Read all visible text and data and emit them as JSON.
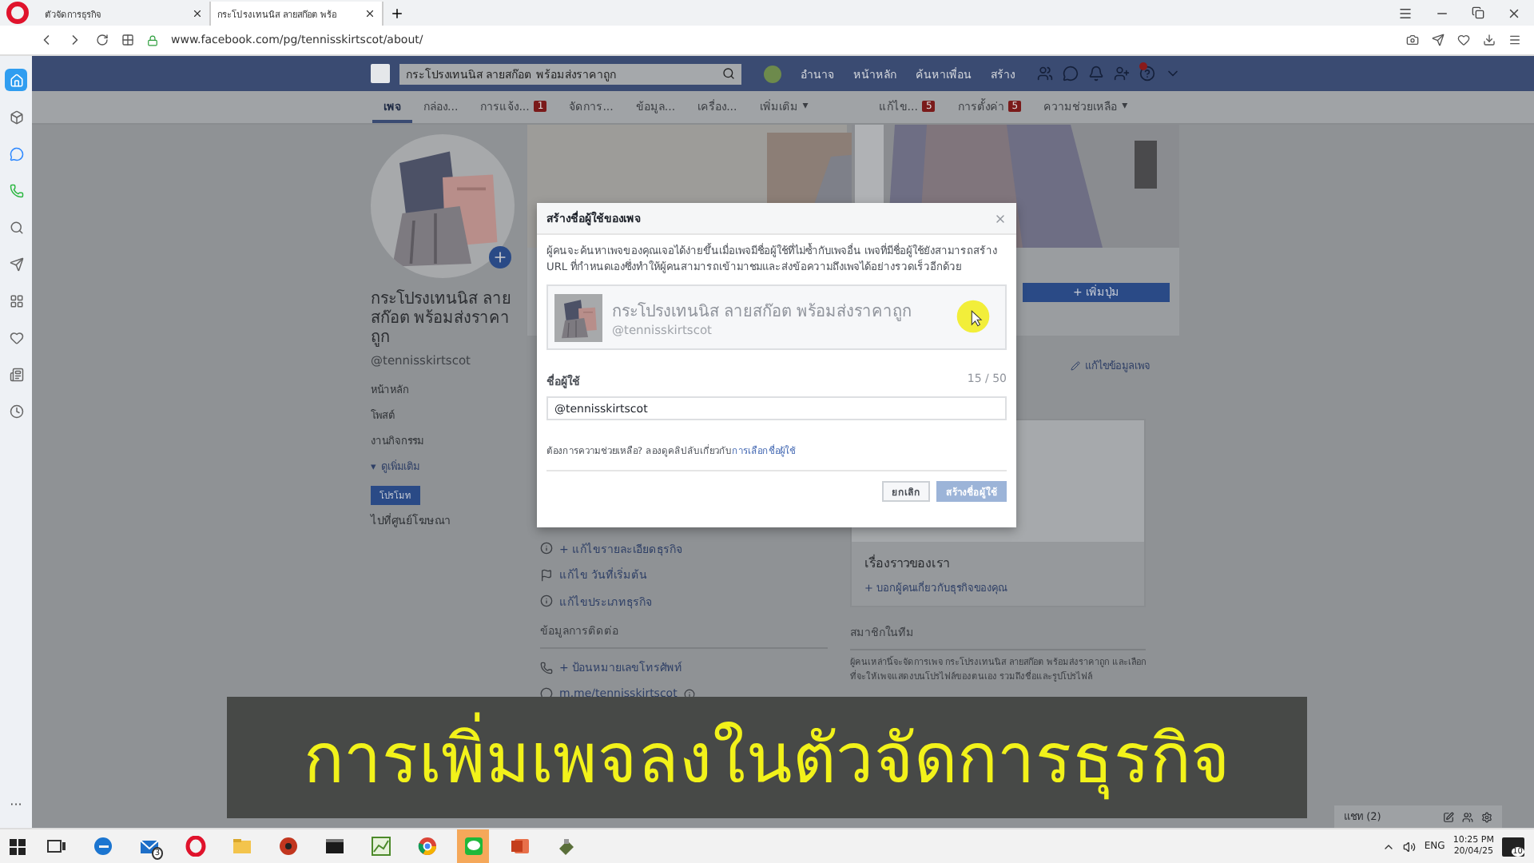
{
  "browser": {
    "tabs": [
      {
        "title": "ตัวจัดการธุรกิจ",
        "selected": false
      },
      {
        "title": "กระโปรงเทนนิส ลายสก๊อต พร้อ",
        "selected": true
      }
    ],
    "address": "www.facebook.com/pg/tennisskirtscot/about/"
  },
  "opera_sidebar": {
    "items": [
      {
        "kind": "home",
        "selected": true
      },
      {
        "kind": "box",
        "selected": false
      },
      {
        "kind": "messenger",
        "selected": false
      },
      {
        "kind": "whatsapp",
        "selected": false
      },
      {
        "kind": "search",
        "selected": false
      },
      {
        "kind": "send",
        "selected": false
      },
      {
        "kind": "grid",
        "selected": false
      },
      {
        "kind": "heart",
        "selected": false
      },
      {
        "kind": "news",
        "selected": false
      },
      {
        "kind": "clock",
        "selected": false
      }
    ],
    "more": "···"
  },
  "facebook_bar": {
    "search": "กระโปรงเทนนิส ลายสก๊อต พร้อมส่งราคาถูก",
    "profile_name": "อำนาจ",
    "links": [
      "หน้าหลัก",
      "ค้นหาเพื่อน",
      "สร้าง"
    ]
  },
  "page_nav": {
    "tabs": [
      {
        "label": "เพจ",
        "selected": true
      },
      {
        "label": "กล่อง...",
        "selected": false
      },
      {
        "label": "การแจ้ง...",
        "badge": "1",
        "selected": false
      },
      {
        "label": "จัดการ...",
        "selected": false
      },
      {
        "label": "ข้อมูล...",
        "selected": false
      },
      {
        "label": "เครื่อง...",
        "selected": false
      },
      {
        "label": "เพิ่มเติม",
        "caret": "▾",
        "selected": false
      }
    ],
    "right_tabs": [
      {
        "label": "แก้ไข...",
        "badge": "5"
      },
      {
        "label": "การตั้งค่า",
        "badge": "5"
      },
      {
        "label": "ความช่วยเหลือ",
        "caret": "▾"
      }
    ]
  },
  "left_column": {
    "name": "กระโปรงเทนนิส ลายสก๊อต พร้อมส่งราคาถูก",
    "handle": "@tennisskirtscot",
    "nav": [
      {
        "label": "หน้าหลัก",
        "kind": "link"
      },
      {
        "label": "โพสต์",
        "kind": "link"
      },
      {
        "label": "งานกิจกรรม",
        "kind": "link"
      },
      {
        "label": "ดูเพิ่มเติม",
        "kind": "more",
        "caret": "▾"
      }
    ],
    "promote_button": "โปรโมท",
    "ads_link": "ไปที่ศูนย์โฆษณา"
  },
  "about_items": [
    {
      "kind": "info",
      "text": "+ แก้ไขรายละเอียดธุรกิจ"
    },
    {
      "kind": "flag",
      "text": "แก้ไข วันที่เริ่มต้น"
    },
    {
      "kind": "info",
      "text": "แก้ไขประเภทธุรกิจ"
    }
  ],
  "contact": {
    "title": "ข้อมูลการติดต่อ",
    "items": [
      {
        "kind": "phone",
        "text": "+ ป้อนหมายเลขโทรศัพท์"
      },
      {
        "kind": "messenger",
        "text": "m.me/tennisskirtscot",
        "info": true
      }
    ]
  },
  "right_column": {
    "add_button": "+ เพิ่มปุ่ม",
    "edit_link": "แก้ไขข้อมูลเพจ",
    "story": {
      "title": "เรื่องราวของเรา",
      "link": "+ บอกผู้คนเกี่ยวกับธุรกิจของคุณ"
    },
    "team": {
      "title": "สมาชิกในทีม",
      "text": "ผู้คนเหล่านี้จะจัดการเพจ กระโปรงเทนนิส ลายสก๊อต พร้อมส่งราคาถูก และเลือกที่จะให้เพจแสดงบนโปรไฟล์ของตนเอง รวมถึงชื่อและรูปโปรไฟล์"
    }
  },
  "dialog": {
    "title": "สร้างชื่อผู้ใช้ของเพจ",
    "description": "ผู้คนจะค้นหาเพจของคุณเจอได้ง่ายขึ้นเมื่อเพจมีชื่อผู้ใช้ที่ไม่ซ้ำกับเพจอื่น เพจที่มีชื่อผู้ใช้ยังสามารถสร้าง URL ที่กำหนดเองซึ่งทำให้ผู้คนสามารถเข้ามาชมและส่งข้อความถึงเพจได้อย่างรวดเร็วอีกด้วย",
    "preview": {
      "name": "กระโปรงเทนนิส ลายสก๊อต พร้อมส่งราคาถูก",
      "handle": "@tennisskirtscot"
    },
    "field_label": "ชื่อผู้ใช้",
    "counter": "15 / 50",
    "value": "@tennisskirtscot",
    "help": "ต้องการความช่วยเหลือ? ลองดูคลิปลับเกี่ยวกับ",
    "help_link": "การเลือกชื่อผู้ใช้",
    "buttons": [
      {
        "label": "ยกเลิก",
        "kind": "cancel",
        "disabled": false
      },
      {
        "label": "สร้างชื่อผู้ใช้",
        "kind": "primary",
        "disabled": true
      }
    ]
  },
  "subtitle": "การเพิ่มเพจลงในตัวจัดการธุรกิจ",
  "chat": {
    "label": "แชท (2)"
  },
  "taskbar": {
    "apps": [
      {
        "kind": "taskview",
        "selected": false
      },
      {
        "kind": "edge",
        "selected": false
      },
      {
        "kind": "mail",
        "badge": "3",
        "selected": false
      },
      {
        "kind": "opera",
        "selected": false
      },
      {
        "kind": "folder",
        "selected": false
      },
      {
        "kind": "media",
        "selected": false
      },
      {
        "kind": "terminal",
        "selected": false
      },
      {
        "kind": "chart",
        "selected": false
      },
      {
        "kind": "chrome",
        "selected": false
      },
      {
        "kind": "line",
        "selected": true
      },
      {
        "kind": "powerpoint",
        "selected": false
      },
      {
        "kind": "tool",
        "selected": false
      }
    ],
    "language": "ENG",
    "time": "10:25 PM",
    "date": "20/04/25",
    "notifications": "10"
  }
}
